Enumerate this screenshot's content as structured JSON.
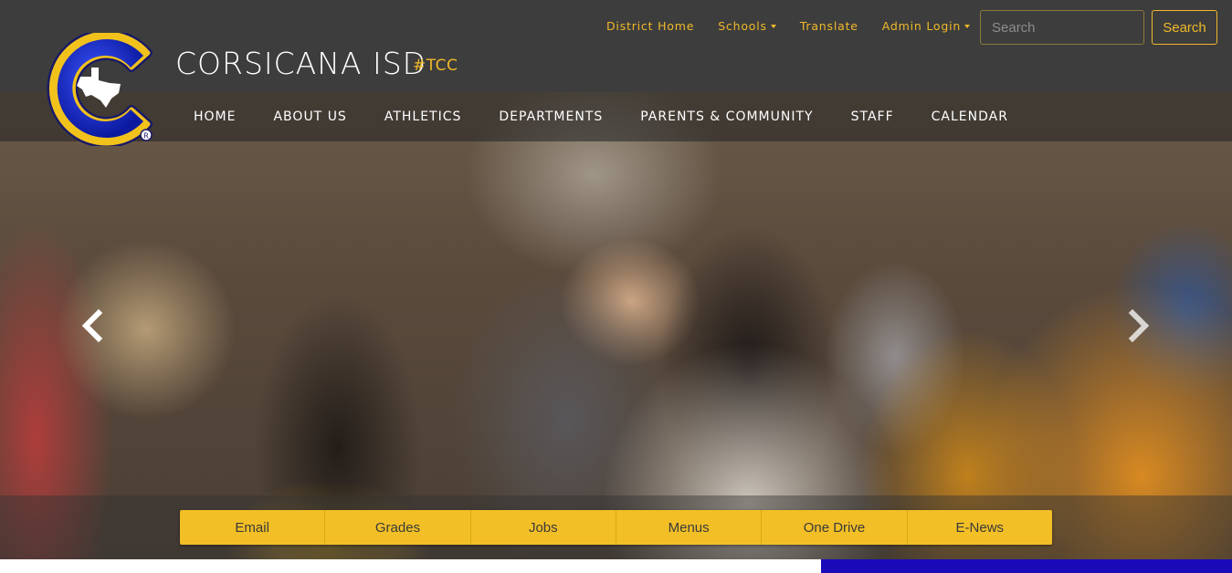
{
  "header": {
    "site_name": "CORSICANA ISD",
    "site_tag": "#TCC",
    "utility_nav": [
      {
        "label": "District Home",
        "dropdown": false
      },
      {
        "label": "Schools",
        "dropdown": true
      },
      {
        "label": "Translate",
        "dropdown": false
      },
      {
        "label": "Admin Login",
        "dropdown": true
      }
    ],
    "search": {
      "placeholder": "Search",
      "button_label": "Search"
    }
  },
  "main_nav": [
    {
      "label": "HOME"
    },
    {
      "label": "ABOUT US"
    },
    {
      "label": "ATHLETICS"
    },
    {
      "label": "DEPARTMENTS"
    },
    {
      "label": "PARENTS & COMMUNITY"
    },
    {
      "label": "STAFF"
    },
    {
      "label": "CALENDAR"
    }
  ],
  "carousel": {
    "prev_icon": "chevron-left-icon",
    "next_icon": "chevron-right-icon"
  },
  "quick_links": [
    {
      "label": "Email"
    },
    {
      "label": "Grades"
    },
    {
      "label": "Jobs"
    },
    {
      "label": "Menus"
    },
    {
      "label": "One Drive"
    },
    {
      "label": "E-News"
    }
  ],
  "colors": {
    "header_bg": "#3d3d3d",
    "accent_gold": "#f0b92a",
    "quicklink_bg": "#f2bf26",
    "brand_blue": "#1a0ab8"
  }
}
